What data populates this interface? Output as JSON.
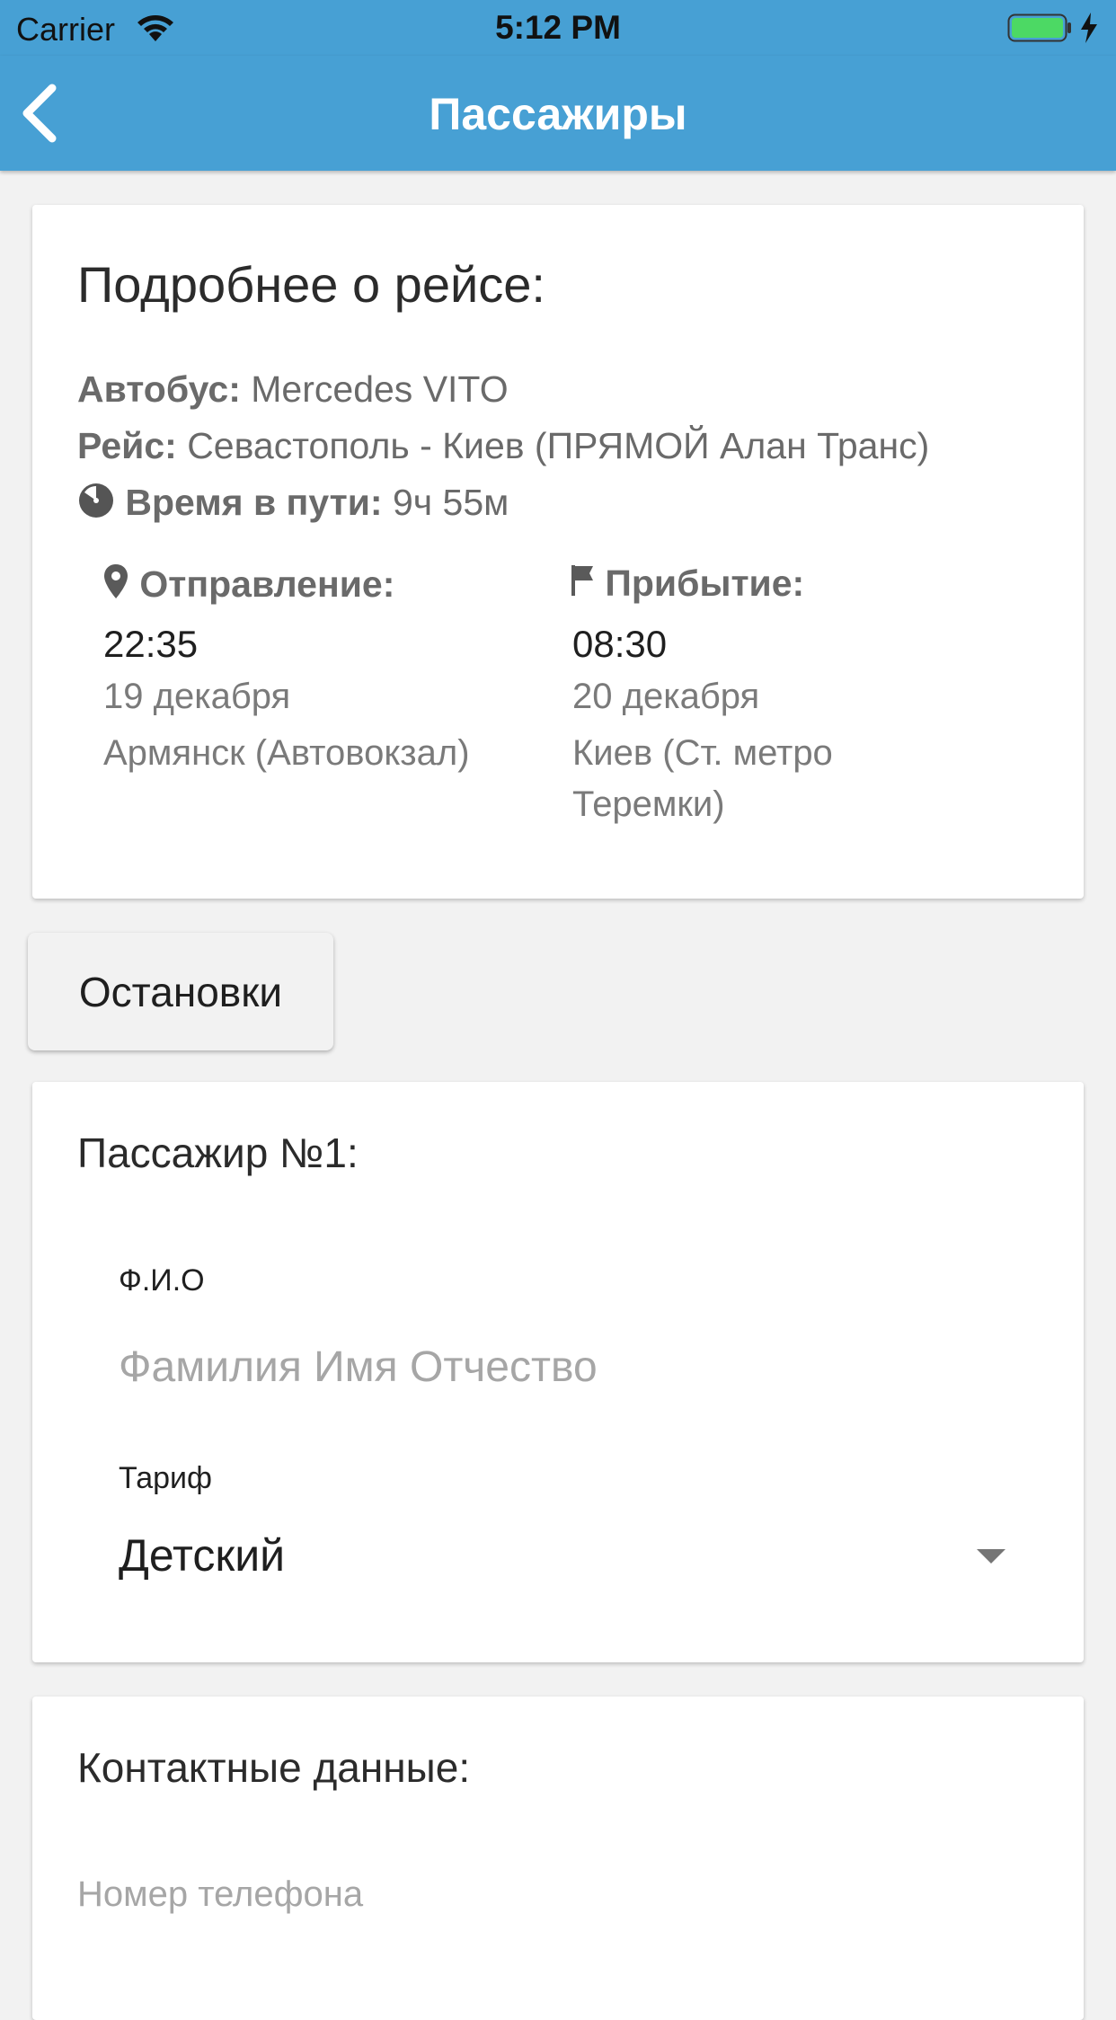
{
  "status_bar": {
    "carrier": "Carrier",
    "time": "5:12 PM"
  },
  "header": {
    "title": "Пассажиры",
    "back_icon": "chevron-left-icon"
  },
  "trip_details": {
    "title": "Подробнее о рейсе:",
    "bus_label": "Автобус:",
    "bus_value": " Mercedes VITO",
    "route_label": "Рейс:",
    "route_value": " Севастополь - Киев (ПРЯМОЙ Алан Транс)",
    "duration_label": "Время в пути:",
    "duration_value": " 9ч 55м",
    "departure": {
      "label": "Отправление:",
      "time": "22:35",
      "date": "19 декабря",
      "place": "Армянск (Автовокзал)"
    },
    "arrival": {
      "label": "Прибытие:",
      "time": "08:30",
      "date": "20 декабря",
      "place": "Киев (Ст. метро Теремки)"
    }
  },
  "stops_button": "Остановки",
  "passenger": {
    "title": "Пассажир №1:",
    "name_label": "Ф.И.О",
    "name_placeholder": "Фамилия Имя Отчество",
    "tariff_label": "Тариф",
    "tariff_value": "Детский"
  },
  "contacts": {
    "title": "Контактные данные:",
    "phone_placeholder": "Номер телефона"
  },
  "colors": {
    "header": "#47a0d4",
    "background": "#f2f2f2",
    "battery": "#4cd964"
  }
}
